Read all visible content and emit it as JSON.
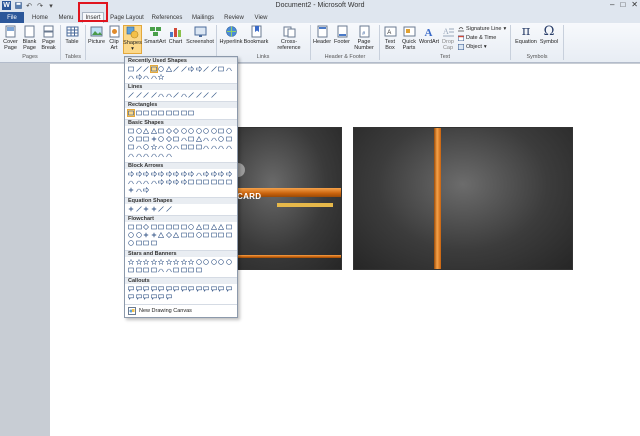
{
  "window": {
    "title": "Document2 - Microsoft Word",
    "app_logo": "W",
    "controls": [
      "–",
      "□",
      "✕"
    ]
  },
  "tabs": [
    {
      "label": "File"
    },
    {
      "label": "Home"
    },
    {
      "label": "Menu"
    },
    {
      "label": "Insert"
    },
    {
      "label": "Page Layout"
    },
    {
      "label": "References"
    },
    {
      "label": "Mailings"
    },
    {
      "label": "Review"
    },
    {
      "label": "View"
    }
  ],
  "ribbon": {
    "pages_group": {
      "label": "Pages",
      "cover_page": "Cover Page",
      "blank_page": "Blank Page",
      "page_break": "Page Break"
    },
    "tables_group": {
      "label": "Tables",
      "table": "Table"
    },
    "illustrations": {
      "picture": "Picture",
      "clip_art": "Clip Art",
      "shapes": "Shapes",
      "smartart": "SmartArt",
      "chart": "Chart",
      "screenshot": "Screenshot"
    },
    "links_group": {
      "label": "Links",
      "hyperlink": "Hyperlink",
      "bookmark": "Bookmark",
      "cross_reference": "Cross-reference"
    },
    "header_footer_group": {
      "label": "Header & Footer",
      "header": "Header",
      "footer": "Footer",
      "page_number": "Page Number"
    },
    "text_group": {
      "label": "Text",
      "text_box": "Text Box",
      "quick_parts": "Quick Parts",
      "wordart": "WordArt",
      "drop_cap": "Drop Cap",
      "signature_line": "Signature Line",
      "date_time": "Date & Time",
      "object": "Object"
    },
    "symbols_group": {
      "label": "Symbols",
      "equation": "Equation",
      "symbol": "Symbol",
      "equation_glyph": "π",
      "symbol_glyph": "Ω"
    }
  },
  "shapes_menu": {
    "sections": [
      "Recently Used Shapes",
      "Lines",
      "Rectangles",
      "Basic Shapes",
      "Block Arrows",
      "Equation Shapes",
      "Flowchart",
      "Stars and Banners",
      "Callouts"
    ],
    "footer": "New Drawing Canvas"
  },
  "document": {
    "card_text": "CARD"
  },
  "colors": {
    "file_tab": "#2b579a",
    "accent_orange": "#d9731a",
    "highlight_red": "#e0141e",
    "card_dark": "#3a3a3a"
  }
}
